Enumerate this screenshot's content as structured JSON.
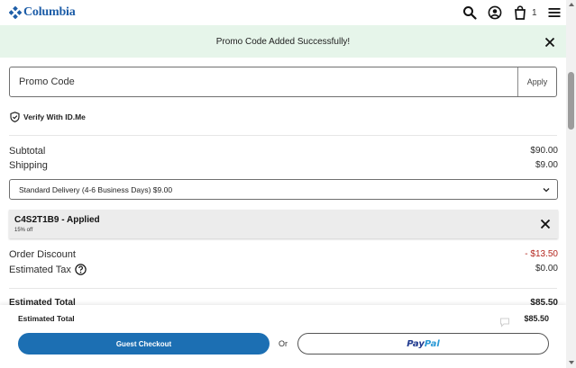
{
  "header": {
    "brand": "Columbia",
    "cart_count": "1",
    "brand_color": "#1e5ea8"
  },
  "banner": {
    "message": "Promo Code Added Successfully!",
    "bg_color": "#e6f5ea"
  },
  "promo": {
    "placeholder": "Promo Code",
    "apply_label": "Apply"
  },
  "verify": {
    "label": "Verify With ID.Me"
  },
  "summary": {
    "subtotal_label": "Subtotal",
    "subtotal_value": "$90.00",
    "shipping_label": "Shipping",
    "shipping_value": "$9.00",
    "shipping_option": "Standard Delivery (4-6 Business Days) $9.00",
    "order_discount_label": "Order Discount",
    "order_discount_value": "- $13.50",
    "estimated_tax_label": "Estimated Tax",
    "estimated_tax_value": "$0.00",
    "estimated_total_label": "Estimated Total",
    "estimated_total_value": "$85.50"
  },
  "coupon": {
    "code_text": "C4S2T1B9 - Applied",
    "discount_text": "15% off"
  },
  "checkout": {
    "total_label": "Estimated Total",
    "total_value": "$85.50",
    "guest_label": "Guest Checkout",
    "or_label": "Or",
    "paypal_part1": "Pay",
    "paypal_part2": "Pal",
    "guest_color": "#1c6fb3",
    "discount_color": "#b3261e"
  },
  "icons": {
    "logo": "columbia-diamond-icon",
    "search": "search-icon",
    "account": "account-icon",
    "cart": "cart-icon",
    "menu": "hamburger-menu-icon",
    "close": "close-icon",
    "shield": "shield-check-icon",
    "chevron": "chevron-down-icon",
    "help": "help-icon",
    "chat": "chat-icon"
  }
}
